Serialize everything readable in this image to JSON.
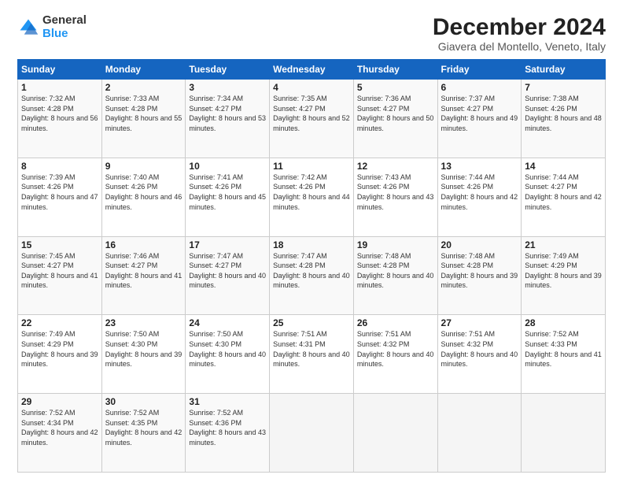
{
  "logo": {
    "general": "General",
    "blue": "Blue"
  },
  "title": "December 2024",
  "location": "Giavera del Montello, Veneto, Italy",
  "days_of_week": [
    "Sunday",
    "Monday",
    "Tuesday",
    "Wednesday",
    "Thursday",
    "Friday",
    "Saturday"
  ],
  "weeks": [
    [
      {
        "day": "1",
        "sunrise": "7:32 AM",
        "sunset": "4:28 PM",
        "daylight": "8 hours and 56 minutes."
      },
      {
        "day": "2",
        "sunrise": "7:33 AM",
        "sunset": "4:28 PM",
        "daylight": "8 hours and 55 minutes."
      },
      {
        "day": "3",
        "sunrise": "7:34 AM",
        "sunset": "4:27 PM",
        "daylight": "8 hours and 53 minutes."
      },
      {
        "day": "4",
        "sunrise": "7:35 AM",
        "sunset": "4:27 PM",
        "daylight": "8 hours and 52 minutes."
      },
      {
        "day": "5",
        "sunrise": "7:36 AM",
        "sunset": "4:27 PM",
        "daylight": "8 hours and 50 minutes."
      },
      {
        "day": "6",
        "sunrise": "7:37 AM",
        "sunset": "4:27 PM",
        "daylight": "8 hours and 49 minutes."
      },
      {
        "day": "7",
        "sunrise": "7:38 AM",
        "sunset": "4:26 PM",
        "daylight": "8 hours and 48 minutes."
      }
    ],
    [
      {
        "day": "8",
        "sunrise": "7:39 AM",
        "sunset": "4:26 PM",
        "daylight": "8 hours and 47 minutes."
      },
      {
        "day": "9",
        "sunrise": "7:40 AM",
        "sunset": "4:26 PM",
        "daylight": "8 hours and 46 minutes."
      },
      {
        "day": "10",
        "sunrise": "7:41 AM",
        "sunset": "4:26 PM",
        "daylight": "8 hours and 45 minutes."
      },
      {
        "day": "11",
        "sunrise": "7:42 AM",
        "sunset": "4:26 PM",
        "daylight": "8 hours and 44 minutes."
      },
      {
        "day": "12",
        "sunrise": "7:43 AM",
        "sunset": "4:26 PM",
        "daylight": "8 hours and 43 minutes."
      },
      {
        "day": "13",
        "sunrise": "7:44 AM",
        "sunset": "4:26 PM",
        "daylight": "8 hours and 42 minutes."
      },
      {
        "day": "14",
        "sunrise": "7:44 AM",
        "sunset": "4:27 PM",
        "daylight": "8 hours and 42 minutes."
      }
    ],
    [
      {
        "day": "15",
        "sunrise": "7:45 AM",
        "sunset": "4:27 PM",
        "daylight": "8 hours and 41 minutes."
      },
      {
        "day": "16",
        "sunrise": "7:46 AM",
        "sunset": "4:27 PM",
        "daylight": "8 hours and 41 minutes."
      },
      {
        "day": "17",
        "sunrise": "7:47 AM",
        "sunset": "4:27 PM",
        "daylight": "8 hours and 40 minutes."
      },
      {
        "day": "18",
        "sunrise": "7:47 AM",
        "sunset": "4:28 PM",
        "daylight": "8 hours and 40 minutes."
      },
      {
        "day": "19",
        "sunrise": "7:48 AM",
        "sunset": "4:28 PM",
        "daylight": "8 hours and 40 minutes."
      },
      {
        "day": "20",
        "sunrise": "7:48 AM",
        "sunset": "4:28 PM",
        "daylight": "8 hours and 39 minutes."
      },
      {
        "day": "21",
        "sunrise": "7:49 AM",
        "sunset": "4:29 PM",
        "daylight": "8 hours and 39 minutes."
      }
    ],
    [
      {
        "day": "22",
        "sunrise": "7:49 AM",
        "sunset": "4:29 PM",
        "daylight": "8 hours and 39 minutes."
      },
      {
        "day": "23",
        "sunrise": "7:50 AM",
        "sunset": "4:30 PM",
        "daylight": "8 hours and 39 minutes."
      },
      {
        "day": "24",
        "sunrise": "7:50 AM",
        "sunset": "4:30 PM",
        "daylight": "8 hours and 40 minutes."
      },
      {
        "day": "25",
        "sunrise": "7:51 AM",
        "sunset": "4:31 PM",
        "daylight": "8 hours and 40 minutes."
      },
      {
        "day": "26",
        "sunrise": "7:51 AM",
        "sunset": "4:32 PM",
        "daylight": "8 hours and 40 minutes."
      },
      {
        "day": "27",
        "sunrise": "7:51 AM",
        "sunset": "4:32 PM",
        "daylight": "8 hours and 40 minutes."
      },
      {
        "day": "28",
        "sunrise": "7:52 AM",
        "sunset": "4:33 PM",
        "daylight": "8 hours and 41 minutes."
      }
    ],
    [
      {
        "day": "29",
        "sunrise": "7:52 AM",
        "sunset": "4:34 PM",
        "daylight": "8 hours and 42 minutes."
      },
      {
        "day": "30",
        "sunrise": "7:52 AM",
        "sunset": "4:35 PM",
        "daylight": "8 hours and 42 minutes."
      },
      {
        "day": "31",
        "sunrise": "7:52 AM",
        "sunset": "4:36 PM",
        "daylight": "8 hours and 43 minutes."
      },
      null,
      null,
      null,
      null
    ]
  ],
  "labels": {
    "sunrise_prefix": "Sunrise: ",
    "sunset_prefix": "Sunset: ",
    "daylight_prefix": "Daylight: "
  }
}
